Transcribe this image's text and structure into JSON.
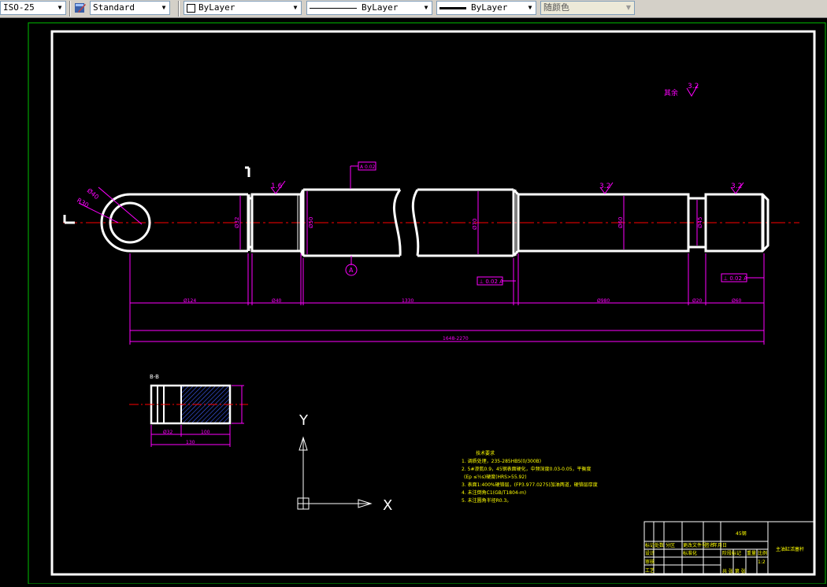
{
  "toolbar": {
    "dimstyle": "ISO-25",
    "textstyle": "Standard",
    "layer_color": "ByLayer",
    "linetype": "ByLayer",
    "lineweight": "ByLayer",
    "plotstyle": "随颜色",
    "icons": [
      "text-style-icon",
      "color-swatch-icon"
    ]
  },
  "drawing": {
    "roughness_corner_label": "其余",
    "roughness_corner_value": "3.2",
    "roughness_1": "1.6",
    "roughness_2": "3.2",
    "roughness_3": "3.2",
    "section_mark": "A",
    "datum_box": "A 0.02",
    "perp_tol_1": "⊥ 0.02 A",
    "perp_tol_2": "⊥ 0.02 A",
    "dims": {
      "d_lug": "Ø40",
      "r_lug": "R30",
      "d_left_shaft": "Ø32",
      "d_groove": "Ø50",
      "d_main": "Ø70",
      "d_mid": "Ø60",
      "d_right": "Ø45",
      "l1": "Ø124",
      "l2": "Ø40",
      "l3": "1330",
      "l4": "Ø980",
      "l5": "Ø20",
      "l6": "Ø60",
      "overall": "1648-2270"
    },
    "detail": {
      "label": "B-B",
      "dim_a": "Ø32",
      "dim_b": "100",
      "dim_total": "130"
    },
    "ucs": {
      "y_label": "Y",
      "x_label": "X"
    },
    "notes": {
      "title": "技术要求",
      "items": [
        "1. 调质处理，235-285HBS(0/300B)",
        "2. 5#渗氮0.9，45钢表面硬化，中频深度0.03-0.05，平衡度",
        "(Ep ≤½s)硬度(HRS>55.92)",
        "3. 表面1:400%硬铬层，(FP3.977.0275)加油两道，硬铬层厚度",
        "4. 未注倒角C1(GB/T1804-m)",
        "5. 未注圆角半径R0.3。"
      ]
    },
    "title_block": {
      "material": "45钢",
      "drawing_name": "主油缸活塞杆",
      "headers": [
        "标记",
        "处数",
        "分区",
        "更改文件号",
        "签名",
        "年月日"
      ],
      "rows": [
        "设计",
        "审核",
        "工艺"
      ],
      "standard": "标准化",
      "stage": "阶段标记",
      "weight": "重量",
      "scale": "比例",
      "scale_val": "1:2",
      "sheet": "共 张 第 张"
    }
  }
}
